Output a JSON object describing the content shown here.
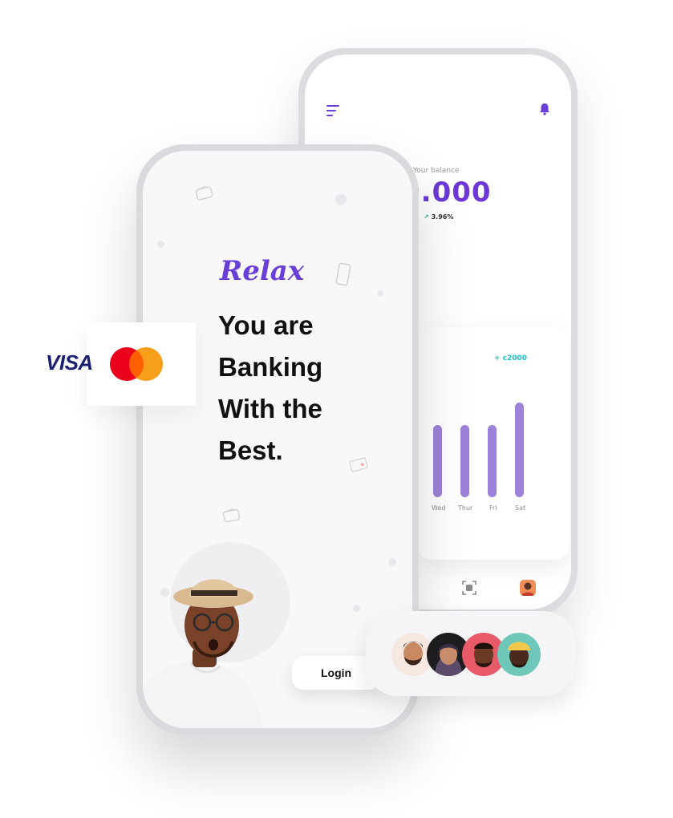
{
  "back_screen": {
    "balance_label": "Your balance",
    "balance_amount": "0.000",
    "balance_change": "3.96%",
    "chart_highlight": "+ c2000",
    "days": [
      "Wed",
      "Thur",
      "Fri",
      "Sat"
    ],
    "icons": {
      "menu": "menu-icon",
      "notifications": "bell-icon",
      "scan": "scan-icon",
      "profile": "profile-icon"
    }
  },
  "front_screen": {
    "script_title": "Relax",
    "headline_lines": [
      "You are",
      "Banking",
      "With the",
      "Best."
    ],
    "login_label": "Login"
  },
  "payment": {
    "visa_label": "VISA",
    "brand_colors": {
      "mastercard_red": "#eb001b",
      "mastercard_orange": "#f79e1b",
      "visa_blue": "#1a1f71"
    }
  },
  "colors": {
    "accent_purple": "#6a3fd7",
    "teal": "#16c4c9",
    "bar_purple": "#9c82d8"
  }
}
